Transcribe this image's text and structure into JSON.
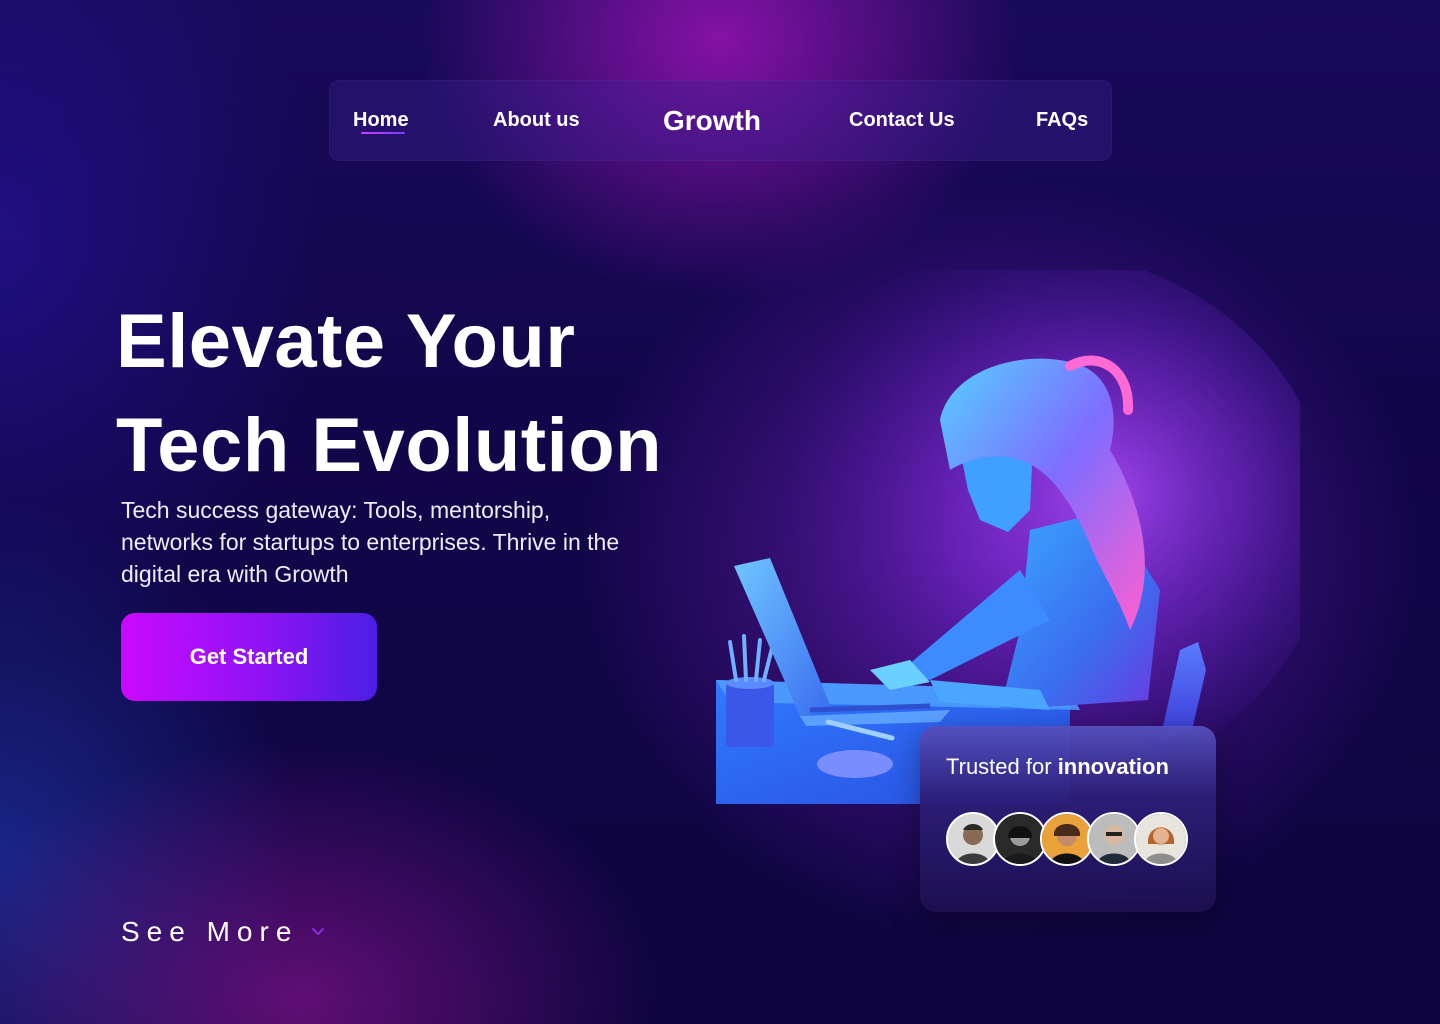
{
  "nav": {
    "items": [
      {
        "label": "Home",
        "active": true
      },
      {
        "label": "About us"
      },
      {
        "label": "Growth"
      },
      {
        "label": "Contact Us"
      },
      {
        "label": "FAQs"
      }
    ]
  },
  "hero": {
    "title_line1": "Elevate Your",
    "title_line2": "Tech Evolution",
    "description": "Tech success gateway: Tools, mentorship, networks for startups to enterprises. Thrive in the digital era with Growth",
    "cta_label": "Get Started"
  },
  "see_more": {
    "label": "See More",
    "icon": "chevron-down-icon"
  },
  "trust": {
    "prefix": "Trusted for",
    "highlight": "innovation",
    "avatars": [
      {
        "icon": "avatar-1"
      },
      {
        "icon": "avatar-2"
      },
      {
        "icon": "avatar-3"
      },
      {
        "icon": "avatar-4"
      },
      {
        "icon": "avatar-5"
      }
    ]
  },
  "colors": {
    "accent": "#cc09ff",
    "accent_end": "#4b1ee6",
    "background": "#12064a"
  }
}
